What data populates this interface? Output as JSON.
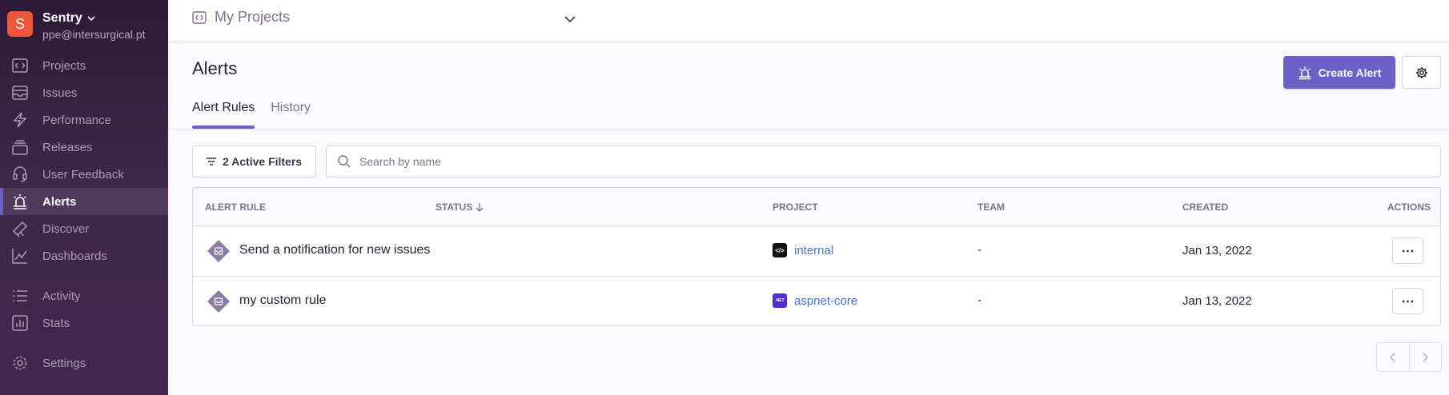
{
  "org": {
    "initial": "S",
    "name": "Sentry",
    "email": "ppe@intersurgical.pt"
  },
  "sidebar": {
    "items": [
      {
        "label": "Projects",
        "icon": "projects-icon"
      },
      {
        "label": "Issues",
        "icon": "issues-icon"
      },
      {
        "label": "Performance",
        "icon": "performance-icon"
      },
      {
        "label": "Releases",
        "icon": "releases-icon"
      },
      {
        "label": "User Feedback",
        "icon": "user-feedback-icon"
      },
      {
        "label": "Alerts",
        "icon": "alerts-icon",
        "active": true
      },
      {
        "label": "Discover",
        "icon": "discover-icon"
      },
      {
        "label": "Dashboards",
        "icon": "dashboards-icon"
      },
      {
        "label": "Activity",
        "icon": "activity-icon"
      },
      {
        "label": "Stats",
        "icon": "stats-icon"
      },
      {
        "label": "Settings",
        "icon": "settings-icon"
      }
    ]
  },
  "topbar": {
    "project_selector": "My Projects"
  },
  "header": {
    "title": "Alerts",
    "create_label": "Create Alert"
  },
  "tabs": [
    {
      "label": "Alert Rules",
      "active": true
    },
    {
      "label": "History",
      "active": false
    }
  ],
  "filters": {
    "label": "2 Active Filters",
    "search_placeholder": "Search by name"
  },
  "table": {
    "columns": {
      "alert_rule": "Alert Rule",
      "status": "Status",
      "project": "Project",
      "team": "Team",
      "created": "Created",
      "actions": "Actions"
    },
    "rows": [
      {
        "name": "Send a notification for new issues",
        "project": "internal",
        "project_badge": "</>",
        "team": "-",
        "created": "Jan 13, 2022"
      },
      {
        "name": "my custom rule",
        "project": "aspnet-core",
        "project_badge": ".NET",
        "team": "-",
        "created": "Jan 13, 2022"
      }
    ],
    "actions_glyph": "⋯"
  },
  "colors": {
    "accent": "#6c5fc7",
    "link": "#3d74db",
    "sidebar": "#3e2648"
  }
}
